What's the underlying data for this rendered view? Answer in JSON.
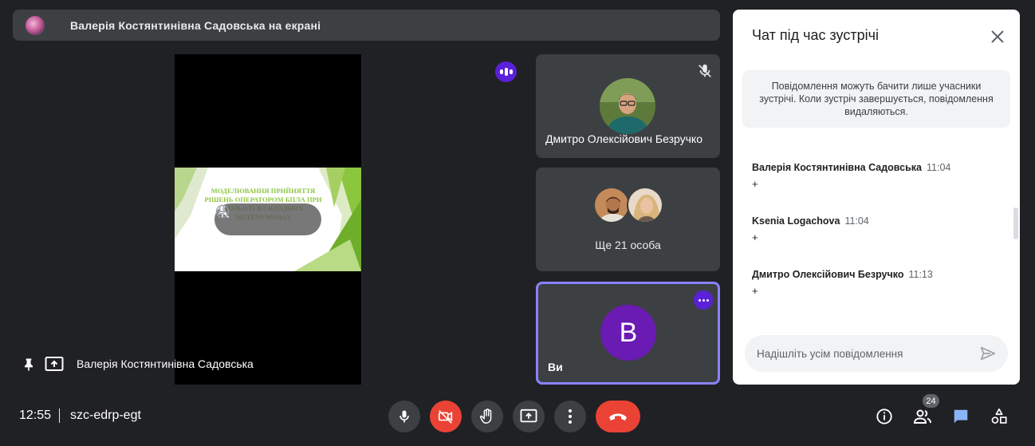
{
  "presenting_bar": {
    "text": "Валерія Костянтинівна Садовська на екрані"
  },
  "stage": {
    "slide_title": "Моделювання прийняття рішень оператором БПЛА при польоті в складних метеоумовах",
    "presenter_label": "Валерія Костянтинівна Садовська"
  },
  "tiles": [
    {
      "name": "Дмитро Олексійович Безручко",
      "mic_muted": true
    },
    {
      "name": "Ще 21 особа"
    },
    {
      "name": "Ви",
      "avatar_letter": "В"
    }
  ],
  "chat": {
    "title": "Чат під час зустрічі",
    "notice": "Повідомлення можуть бачити лише учасники зустрічі. Коли зустріч завершується, повідомлення видаляються.",
    "messages": [
      {
        "author": "Валерія Костянтинівна Садовська",
        "time": "11:04",
        "text": "+"
      },
      {
        "author": "Ksenia Logachova",
        "time": "11:04",
        "text": "+"
      },
      {
        "author": "Дмитро Олексійович Безручко",
        "time": "11:13",
        "text": "+"
      }
    ],
    "input_placeholder": "Надішліть усім повідомлення"
  },
  "bottom_bar": {
    "time": "12:55",
    "meeting_code": "szc-edrp-egt",
    "people_count": "24"
  },
  "colors": {
    "background": "#202124",
    "tile": "#3c4043",
    "accent_purple": "#5b21d9",
    "danger_red": "#ea4335",
    "chat_icon_blue": "#8ab4f8",
    "slide_green": "#8cc63f"
  }
}
